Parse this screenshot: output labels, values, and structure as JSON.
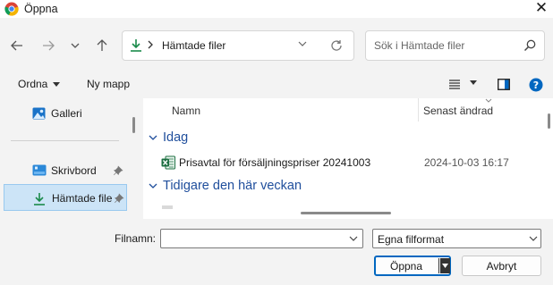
{
  "window": {
    "title": "Öppna",
    "close_glyph": "✕",
    "app_icon": "chrome-icon"
  },
  "nav": {
    "back_icon": "arrow-left-icon",
    "forward_icon": "arrow-right-icon",
    "recent_icon": "chevron-down-icon",
    "up_icon": "arrow-up-icon",
    "address": {
      "icon": "download-icon",
      "path": "Hämtade filer"
    },
    "search": {
      "placeholder": "Sök i Hämtade filer",
      "icon": "search-icon"
    }
  },
  "commands": {
    "organize": "Ordna",
    "new_folder": "Ny mapp",
    "view_icon": "list-view-icon",
    "preview_icon": "preview-pane-icon",
    "help_icon": "help-icon"
  },
  "sidebar": {
    "items": [
      {
        "label": "Galleri",
        "icon": "gallery-icon",
        "pinned": false,
        "selected": false
      },
      {
        "label": "Skrivbord",
        "icon": "desktop-icon",
        "pinned": true,
        "selected": false
      },
      {
        "label": "Hämtade file",
        "icon": "download-icon",
        "pinned": true,
        "selected": true
      }
    ]
  },
  "list": {
    "columns": {
      "name": "Namn",
      "modified": "Senast ändrad"
    },
    "groups": [
      {
        "title": "Idag",
        "files": [
          {
            "name": "Prisavtal för försäljningspriser 20241003",
            "modified": "2024-10-03 16:17",
            "icon": "excel-icon"
          }
        ]
      },
      {
        "title": "Tidigare den här veckan",
        "files": []
      }
    ]
  },
  "footer": {
    "filename_label": "Filnamn:",
    "filename_value": "",
    "filetype": "Egna filformat",
    "open_label": "Öppna",
    "cancel_label": "Avbryt"
  },
  "colors": {
    "accent": "#0067c0",
    "group_heading": "#1f4e9c",
    "selection": "#cce4f7",
    "excel": "#1d6f42",
    "download": "#1a8a4a"
  }
}
